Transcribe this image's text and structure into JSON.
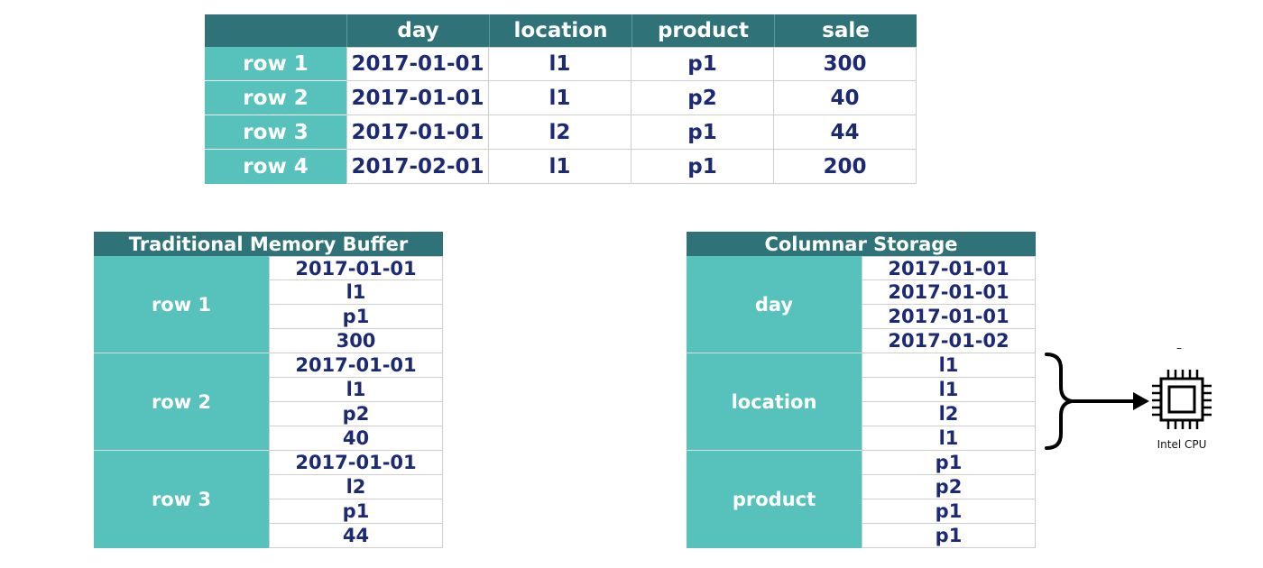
{
  "top_table": {
    "columns": [
      "day",
      "location",
      "product",
      "sale"
    ],
    "rows": [
      {
        "label": "row 1",
        "cells": [
          "2017-01-01",
          "l1",
          "p1",
          "300"
        ]
      },
      {
        "label": "row 2",
        "cells": [
          "2017-01-01",
          "l1",
          "p2",
          "40"
        ]
      },
      {
        "label": "row 3",
        "cells": [
          "2017-01-01",
          "l2",
          "p1",
          "44"
        ]
      },
      {
        "label": "row 4",
        "cells": [
          "2017-02-01",
          "l1",
          "p1",
          "200"
        ]
      }
    ]
  },
  "row_buffer": {
    "title": "Traditional Memory Buffer",
    "groups": [
      {
        "label": "row 1",
        "values": [
          "2017-01-01",
          "l1",
          "p1",
          "300"
        ]
      },
      {
        "label": "row 2",
        "values": [
          "2017-01-01",
          "l1",
          "p2",
          "40"
        ]
      },
      {
        "label": "row 3",
        "values": [
          "2017-01-01",
          "l2",
          "p1",
          "44"
        ]
      }
    ]
  },
  "columnar": {
    "title": "Columnar Storage",
    "groups": [
      {
        "label": "day",
        "values": [
          "2017-01-01",
          "2017-01-01",
          "2017-01-01",
          "2017-01-02"
        ]
      },
      {
        "label": "location",
        "values": [
          "l1",
          "l1",
          "l2",
          "l1"
        ]
      },
      {
        "label": "product",
        "values": [
          "p1",
          "p2",
          "p1",
          "p1"
        ]
      }
    ]
  },
  "cpu": {
    "label": "Intel CPU",
    "icon": "cpu-chip-icon",
    "mark": "–"
  },
  "colors": {
    "header": "#2f7378",
    "label": "#56c2bb",
    "value_text": "#1c2a73"
  }
}
